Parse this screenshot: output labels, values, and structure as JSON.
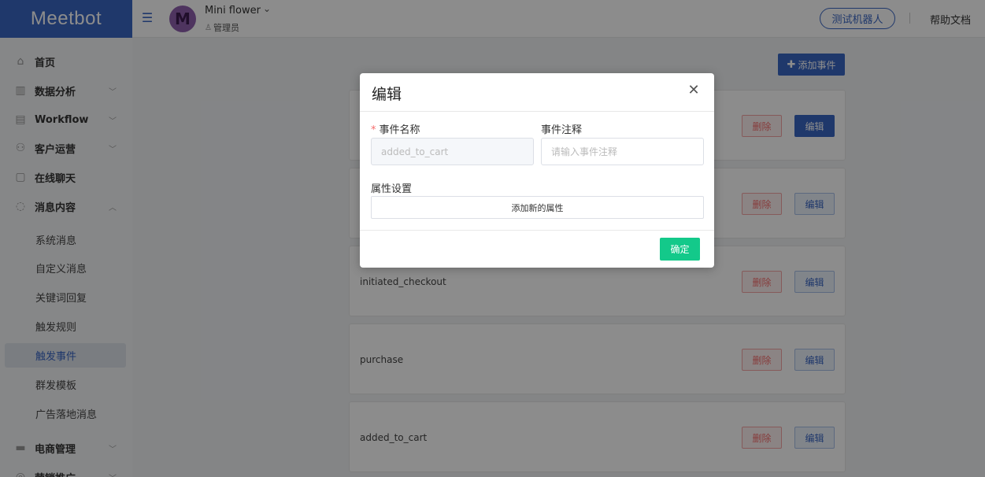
{
  "header": {
    "logo": "Meetbot",
    "account": {
      "avatar_letter": "M",
      "name": "Mini flower",
      "role": "管理员"
    },
    "test_bot": "测试机器人",
    "help_docs": "帮助文档"
  },
  "sidebar": {
    "items": [
      {
        "label": "首页",
        "icon": "home-icon"
      },
      {
        "label": "数据分析",
        "icon": "chart-icon"
      },
      {
        "label": "Workflow",
        "icon": "workflow-icon"
      },
      {
        "label": "客户运营",
        "icon": "users-icon"
      },
      {
        "label": "在线聊天",
        "icon": "chat-icon"
      },
      {
        "label": "消息内容",
        "icon": "message-icon"
      }
    ],
    "sub_items": [
      {
        "label": "系统消息"
      },
      {
        "label": "自定义消息"
      },
      {
        "label": "关键词回复"
      },
      {
        "label": "触发规则"
      },
      {
        "label": "触发事件",
        "active": true
      },
      {
        "label": "群发模板"
      },
      {
        "label": "广告落地消息"
      }
    ],
    "bottom_items": [
      {
        "label": "电商管理",
        "icon": "shop-icon"
      },
      {
        "label": "营销推广",
        "icon": "promo-icon"
      }
    ]
  },
  "main": {
    "add_event_label": "添加事件",
    "events": [
      {
        "name": ""
      },
      {
        "name": ""
      },
      {
        "name": "initiated_checkout"
      },
      {
        "name": "purchase"
      },
      {
        "name": "added_to_cart"
      }
    ],
    "delete_label": "删除",
    "edit_label": "编辑"
  },
  "modal": {
    "title": "编辑",
    "event_name_label": "事件名称",
    "event_name_value": "added_to_cart",
    "event_note_label": "事件注释",
    "event_note_placeholder": "请输入事件注释",
    "attr_label": "属性设置",
    "add_attr_label": "添加新的属性",
    "confirm_label": "确定"
  }
}
